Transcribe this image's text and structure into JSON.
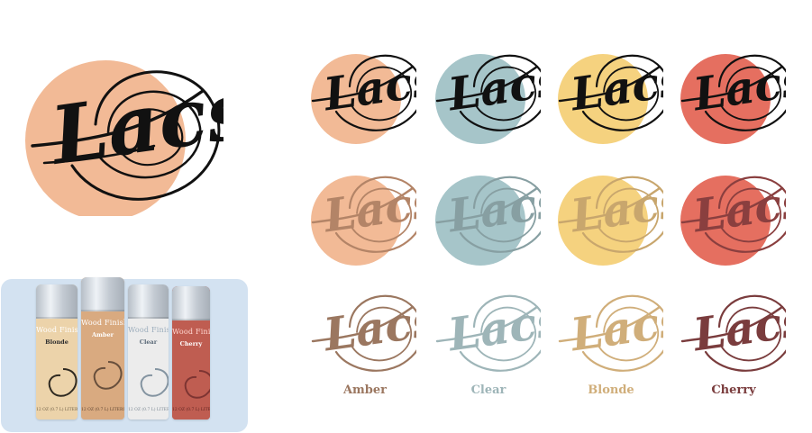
{
  "brand": {
    "wordmark": "Lacs"
  },
  "colors": {
    "peach": "#f2ba96",
    "blue": "#a6c5c9",
    "yellow": "#f5d27f",
    "red": "#e56f60",
    "amber_text": "#9b7760",
    "clear_text": "#9eb5b8",
    "blonde_text": "#d0ae7a",
    "cherry_text": "#7a3c3d",
    "panel_bg": "#d3e2f1"
  },
  "swatches": [
    {
      "name": "Amber",
      "fill": "#f2ba96",
      "text": "#9b7760"
    },
    {
      "name": "Clear",
      "fill": "#a6c5c9",
      "text": "#9eb5b8"
    },
    {
      "name": "Blonde",
      "fill": "#f5d27f",
      "text": "#d0ae7a"
    },
    {
      "name": "Cherry",
      "fill": "#e56f60",
      "text": "#7a3c3d"
    }
  ],
  "products": [
    {
      "wood_finish": "Wood Finish",
      "name": "Blonde",
      "fine_print": "12 OZ (0.7 L) LITERS",
      "body": "#ecd3aa",
      "swirl": "#000000"
    },
    {
      "wood_finish": "Wood Finish",
      "name": "Amber",
      "fine_print": "12 OZ (0.7 L) LITERS",
      "body": "#d9aa80",
      "swirl": "#4c392c"
    },
    {
      "wood_finish": "Wood Finish",
      "name": "Clear",
      "fine_print": "12 OZ (0.7 L) LITERS",
      "body": "#ececec",
      "swirl": "#6b7f8f"
    },
    {
      "wood_finish": "Wood Finish",
      "name": "Cherry",
      "fine_print": "12 OZ (0.7 L) LITERS",
      "body": "#bf5d51",
      "swirl": "#6d2b2b"
    }
  ]
}
